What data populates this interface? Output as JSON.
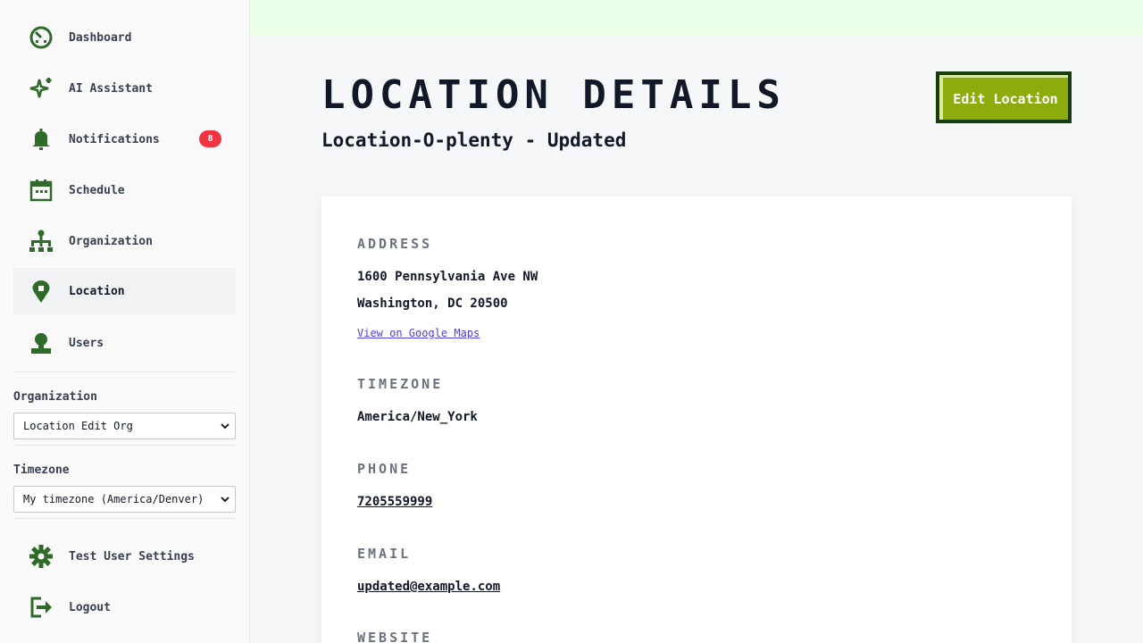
{
  "sidebar": {
    "nav": [
      {
        "label": "Dashboard",
        "icon": "dashboard-icon"
      },
      {
        "label": "AI Assistant",
        "icon": "sparkle-icon"
      },
      {
        "label": "Notifications",
        "icon": "bell-icon",
        "badge": "8"
      },
      {
        "label": "Schedule",
        "icon": "calendar-icon"
      },
      {
        "label": "Organization",
        "icon": "org-chart-icon"
      },
      {
        "label": "Location",
        "icon": "map-pin-icon",
        "active": true
      },
      {
        "label": "Users",
        "icon": "user-icon"
      }
    ],
    "organization_label": "Organization",
    "organization_value": "Location Edit Org",
    "timezone_label": "Timezone",
    "timezone_value": "My timezone (America/Denver)",
    "settings_label": "Test User Settings",
    "logout_label": "Logout"
  },
  "header": {
    "title": "LOCATION DETAILS",
    "subtitle": "Location-O-plenty - Updated",
    "edit_button": "Edit Location"
  },
  "details": {
    "address_label": "ADDRESS",
    "address_line1": "1600 Pennsylvania Ave NW",
    "address_line2": "Washington, DC 20500",
    "maps_link": "View on Google Maps",
    "timezone_label": "TIMEZONE",
    "timezone_value": "America/New_York",
    "phone_label": "PHONE",
    "phone_value": "7205559999",
    "email_label": "EMAIL",
    "email_value": "updated@example.com",
    "website_label": "WEBSITE"
  },
  "colors": {
    "icon_green": "#2e6b2a",
    "button_green": "#8cac0e",
    "button_border": "#1a3d0d",
    "badge_red": "#ef3340",
    "banner": "#ebffe6",
    "link_blue": "#4b3fe0"
  }
}
